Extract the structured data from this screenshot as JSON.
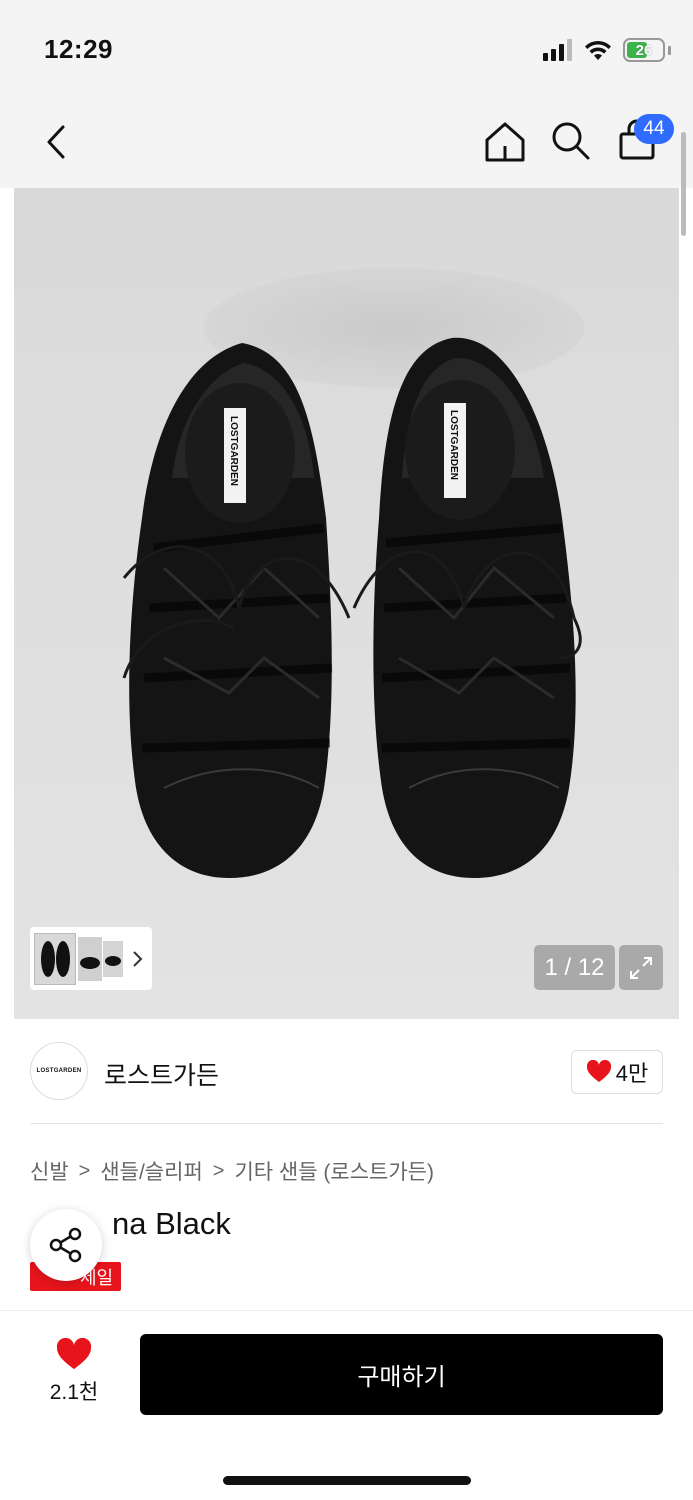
{
  "status_bar": {
    "time": "12:29",
    "battery": "26",
    "icons": [
      "signal-icon",
      "wifi-icon",
      "battery-icon"
    ]
  },
  "nav": {
    "icons": [
      "back-icon",
      "home-icon",
      "search-icon",
      "cart-icon"
    ],
    "cart_count": "44"
  },
  "gallery": {
    "counter": "1 / 12",
    "shoe_tag": "LOSTGARDEN",
    "background": "#dedede"
  },
  "brand": {
    "logo_text": "LOSTGARDEN",
    "name": "로스트가든",
    "likes": "4만"
  },
  "breadcrumb": {
    "items": [
      "신발",
      "샌들/슬리퍼",
      "기타 샌들 (로스트가든)"
    ],
    "separator": ">"
  },
  "product": {
    "title_visible": "na Black",
    "badge": "세일"
  },
  "bottom": {
    "wish_count": "2.1천",
    "buy_label": "구매하기"
  },
  "colors": {
    "accent": "#2f6bff",
    "heart": "#e8141c",
    "sale": "#e8141c",
    "buy_button": "#000000"
  }
}
